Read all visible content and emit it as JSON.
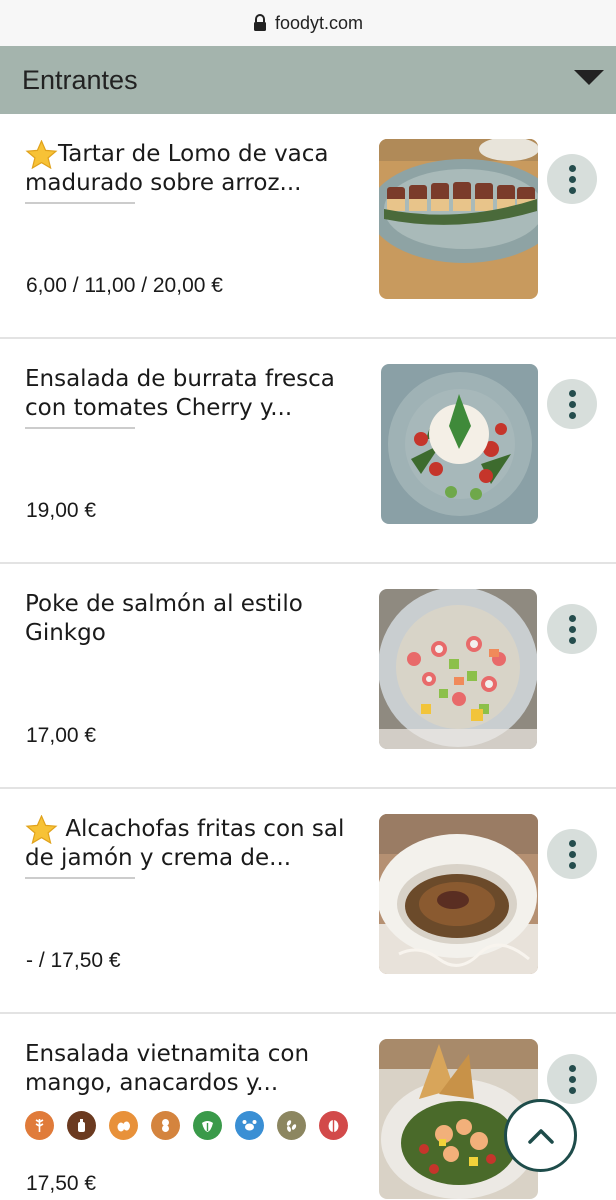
{
  "browser": {
    "url": "foodyt.com",
    "lock_icon": "lock-icon"
  },
  "section": {
    "title": "Entrantes",
    "toggle_icon": "caret-down-icon",
    "header_color": "#a4b4ad"
  },
  "items": [
    {
      "name": "Tartar de Lomo de vaca madurado sobre arroz...",
      "featured": true,
      "price": "6,00 / 11,00 / 20,00 €",
      "photo": "tartar-photo"
    },
    {
      "name": "Ensalada de burrata fresca con tomates Cherry y...",
      "featured": false,
      "price": "19,00 €",
      "photo": "burrata-photo"
    },
    {
      "name": "Poke de salmón al estilo Ginkgo",
      "featured": false,
      "price": "17,00 €",
      "photo": "poke-photo"
    },
    {
      "name": "Alcachofas fritas con sal de jamón y crema de...",
      "featured": true,
      "price": "- / 17,50 €",
      "photo": "artichoke-photo"
    },
    {
      "name": "Ensalada vietnamita con mango, anacardos y...",
      "featured": false,
      "price": "17,50 €",
      "photo": "vietnamese-salad-photo"
    }
  ],
  "allergens": [
    {
      "icon": "gluten-icon",
      "color": "#e07b3a"
    },
    {
      "icon": "mustard-icon",
      "color": "#6b3a20"
    },
    {
      "icon": "egg-icon",
      "color": "#e8913a"
    },
    {
      "icon": "peanut-icon",
      "color": "#d4843e"
    },
    {
      "icon": "celery-icon",
      "color": "#3a9a4a"
    },
    {
      "icon": "crustacean-icon",
      "color": "#3a8fd4"
    },
    {
      "icon": "sesame-icon",
      "color": "#8c8660"
    },
    {
      "icon": "nuts-icon",
      "color": "#d24a4a"
    }
  ],
  "scroll_top": {
    "icon": "chevron-up-icon",
    "color": "#1e4c4a"
  },
  "more_icon": "more-vertical-icon"
}
